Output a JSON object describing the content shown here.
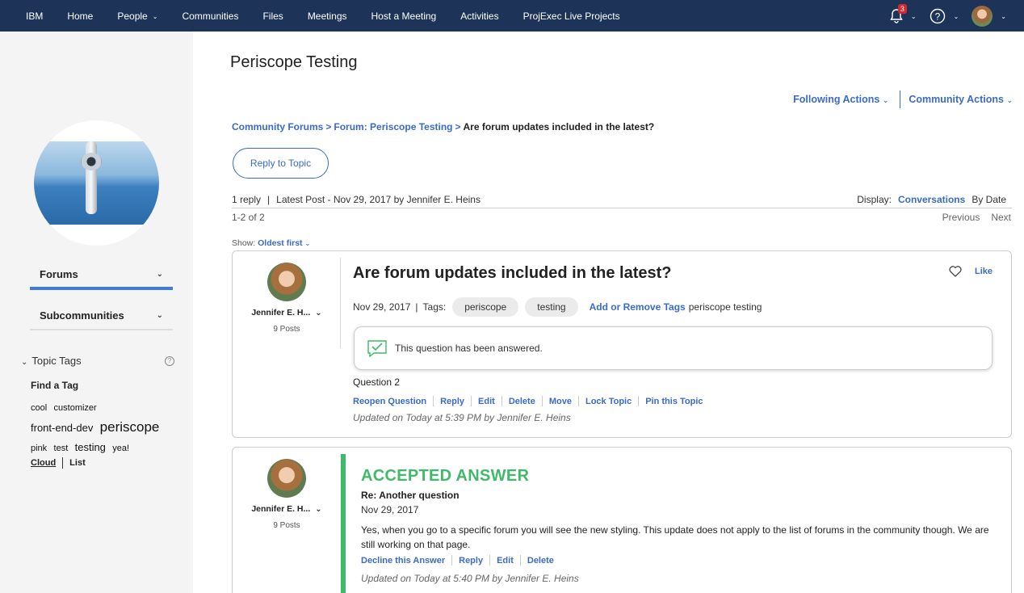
{
  "nav": {
    "items": [
      {
        "label": "IBM",
        "caret": false
      },
      {
        "label": "Home",
        "caret": false
      },
      {
        "label": "People",
        "caret": true
      },
      {
        "label": "Communities",
        "caret": false
      },
      {
        "label": "Files",
        "caret": false
      },
      {
        "label": "Meetings",
        "caret": false
      },
      {
        "label": "Host a Meeting",
        "caret": false
      },
      {
        "label": "Activities",
        "caret": false
      },
      {
        "label": "ProjExec Live Projects",
        "caret": false
      }
    ],
    "notification_count": "3"
  },
  "sidebar": {
    "tabs": {
      "forums": "Forums",
      "subcommunities": "Subcommunities"
    },
    "topic_tags_heading": "Topic Tags",
    "find_tag": "Find a Tag",
    "tags": [
      {
        "label": "cool",
        "size": "tc1"
      },
      {
        "label": "customizer",
        "size": "tc1"
      },
      {
        "label": "front-end-dev",
        "size": "tc4"
      },
      {
        "label": "periscope",
        "size": "tc3"
      },
      {
        "label": "pink",
        "size": "tc1"
      },
      {
        "label": "test",
        "size": "tc1"
      },
      {
        "label": "testing",
        "size": "tc4"
      },
      {
        "label": "yea!",
        "size": "tc1"
      }
    ],
    "cloud_label": "Cloud",
    "list_label": "List"
  },
  "main": {
    "title": "Periscope Testing",
    "following_actions": "Following Actions",
    "community_actions": "Community Actions",
    "breadcrumb": {
      "community_forums": "Community Forums",
      "forum": "Forum: Periscope Testing",
      "current": "Are forum updates included in the latest?"
    },
    "reply_to_topic": "Reply to Topic",
    "stats": {
      "replies": "1 reply",
      "latest_post": "Latest Post - Nov 29, 2017 by Jennifer E. Heins",
      "display_label": "Display:",
      "conversations": "Conversations",
      "by_date": "By Date"
    },
    "paging": {
      "range": "1-2 of 2",
      "previous": "Previous",
      "next": "Next"
    },
    "show": {
      "label": "Show:",
      "value": "Oldest first"
    }
  },
  "topic": {
    "author": "Jennifer E. H...",
    "posts": "9 Posts",
    "title": "Are forum updates included in the latest?",
    "like": "Like",
    "date": "Nov 29, 2017",
    "tags_label": "Tags:",
    "tags": [
      "periscope",
      "testing"
    ],
    "add_remove_tags": "Add or Remove Tags",
    "tags_text": "periscope testing",
    "answered_notice": "This question has been answered.",
    "body": "Question 2",
    "actions": [
      "Reopen Question",
      "Reply",
      "Edit",
      "Delete",
      "Move",
      "Lock Topic",
      "Pin this Topic"
    ],
    "updated": "Updated on Today at 5:39 PM by Jennifer E. Heins"
  },
  "answer": {
    "author": "Jennifer E. H...",
    "posts": "9 Posts",
    "accepted_label": "ACCEPTED ANSWER",
    "title": "Re: Another question",
    "date": "Nov 29, 2017",
    "body": "Yes, when you go to a specific forum you will see the new styling. This update does not apply to the list of forums in the community though. We are still working on that page.",
    "actions": [
      "Decline this Answer",
      "Reply",
      "Edit",
      "Delete"
    ],
    "updated": "Updated on Today at 5:40 PM by Jennifer E. Heins"
  }
}
